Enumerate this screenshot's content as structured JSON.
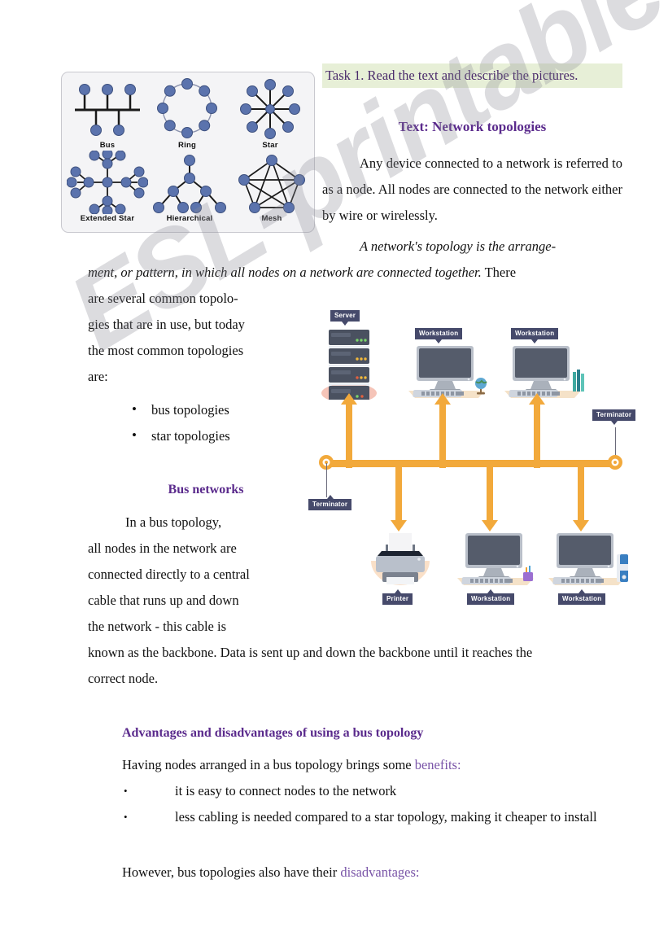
{
  "worksheet": {
    "watermark": "ESL-printables.com",
    "accent_purple": "#5a2a8c",
    "accent_light_purple": "#7a55a8",
    "banner_bg": "#e7efd7",
    "diagram_orange": "#f2a93b",
    "tag_navy": "#464a6b",
    "node_blue": "#5b73ad"
  },
  "task": {
    "banner_text": "Task 1. Read the text and describe the pictures."
  },
  "headings": {
    "text_title": "Text: Network topologies",
    "bus_networks": "Bus networks",
    "advantages": "Advantages and disadvantages of using a bus topology"
  },
  "topology_figure": {
    "name": "network-topology-types",
    "items": [
      {
        "label": "Bus",
        "icon": "bus-topology-icon"
      },
      {
        "label": "Ring",
        "icon": "ring-topology-icon"
      },
      {
        "label": "Star",
        "icon": "star-topology-icon"
      },
      {
        "label": "Extended Star",
        "icon": "extended-star-topology-icon"
      },
      {
        "label": "Hierarchical",
        "icon": "hierarchical-topology-icon"
      },
      {
        "label": "Mesh",
        "icon": "mesh-topology-icon"
      }
    ]
  },
  "body": {
    "p1": "Any device connected to a network is referred to as a node. All nodes are connected to the network either by wire or wirelessly.",
    "p2_italic": "A network's topology is the arrangement, or pattern, in which all nodes on a network are connected together.",
    "p2_tail": " There are several common topologies that are in use, but today the most common topologies are:",
    "topology_bullets": [
      "bus topologies",
      "star topologies"
    ],
    "p3": "In a bus topology, all nodes in the network are connected directly to a central cable that runs up and down the network - this cable is known as the backbone. Data is sent up and down the backbone until it reaches the correct node.",
    "benefits_lead_pre": "Having nodes arranged in a bus topology brings some ",
    "benefits_lead_accent": "benefits:",
    "benefits": [
      "it is easy to connect nodes to the network",
      "less cabling is needed compared to a star topology, making it cheaper to install"
    ],
    "disadvantages_lead_pre": "However, bus topologies also have their ",
    "disadvantages_lead_accent": "disadvantages:"
  },
  "network_diagram": {
    "name": "bus-topology-network-diagram",
    "labels": {
      "server": "Server",
      "workstation": "Workstation",
      "printer": "Printer",
      "terminator": "Terminator"
    },
    "top_devices": [
      {
        "type": "server",
        "label": "Server"
      },
      {
        "type": "workstation",
        "label": "Workstation"
      },
      {
        "type": "workstation",
        "label": "Workstation"
      }
    ],
    "bottom_devices": [
      {
        "type": "printer",
        "label": "Printer"
      },
      {
        "type": "workstation",
        "label": "Workstation"
      },
      {
        "type": "workstation",
        "label": "Workstation"
      }
    ],
    "terminators": [
      {
        "label": "Terminator",
        "side": "left"
      },
      {
        "label": "Terminator",
        "side": "right"
      }
    ]
  }
}
